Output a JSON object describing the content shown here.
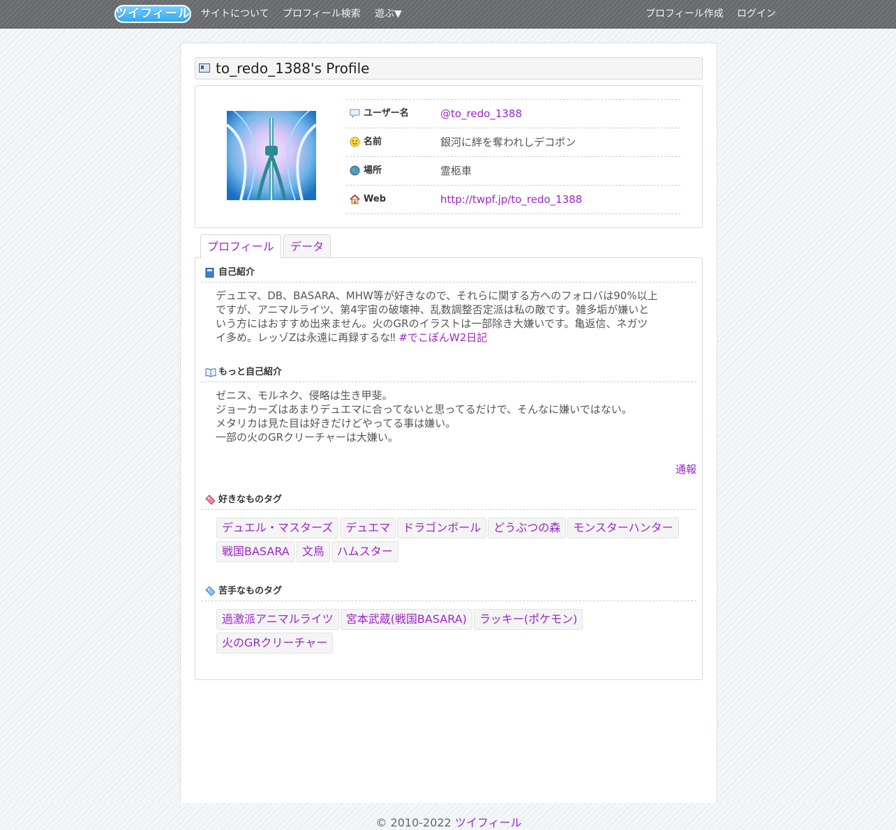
{
  "nav": {
    "logo": "ツイフィール",
    "about": "サイトについて",
    "search": "プロフィール検索",
    "play": "遊ぶ▼",
    "create": "プロフィール作成",
    "login": "ログイン"
  },
  "profile": {
    "title": "to_redo_1388's Profile",
    "rows": [
      {
        "label": "ユーザー名",
        "value": "@to_redo_1388",
        "icon": "speech-bubble-icon"
      },
      {
        "label": "名前",
        "value": "銀河に絆を奪われしデコポン",
        "icon": "smiley-icon"
      },
      {
        "label": "場所",
        "value": "霊柩車",
        "icon": "globe-icon"
      },
      {
        "label": "Web",
        "value": "http://twpf.jp/to_redo_1388",
        "icon": "house-icon"
      }
    ]
  },
  "tabs": {
    "profile": "プロフィール",
    "data": "データ"
  },
  "intro": {
    "title": "自己紹介",
    "lines": [
      "デュエマ、DB、BASARA、MHW等が好きなので、それらに関する方へのフォロバは90%以上",
      "ですが、アニマルライツ、第4宇宙の破壊神、乱数調整否定派は私の敵です。雑多垢が嫌いと",
      "いう方にはおすすめ出来ません。火のGRのイラストは一部除き大嫌いです。亀返信、ネガツ",
      "イ多め。レッゾZは永遠に再録するな‼︎"
    ],
    "hashtag": "#でこぽんW2日記"
  },
  "more": {
    "title": "もっと自己紹介",
    "lines": [
      "ゼニス、モルネク、侵略は生き甲斐。",
      "ジョーカーズはあまりデュエマに合ってないと思ってるだけで、そんなに嫌いではない。",
      "メタリカは見た目は好きだけどやってる事は嫌い。",
      "一部の火のGRクリーチャーは大嫌い。"
    ]
  },
  "report": "通報",
  "likes": {
    "title": "好きなものタグ",
    "tags": [
      "デュエル・マスターズ",
      "デュエマ",
      "ドラゴンボール",
      "どうぶつの森",
      "モンスターハンター",
      "戦国BASARA",
      "文鳥",
      "ハムスター"
    ]
  },
  "dislikes": {
    "title": "苦手なものタグ",
    "tags": [
      "過激派アニマルライツ",
      "宮本武蔵(戦国BASARA)",
      "ラッキー(ポケモン)",
      "火のGRクリーチャー"
    ]
  },
  "footer": {
    "copyright": "© 2010-2022",
    "site": "ツイフィール"
  },
  "colors": {
    "link": "#9b27c6",
    "topbar": "#6e7173"
  }
}
